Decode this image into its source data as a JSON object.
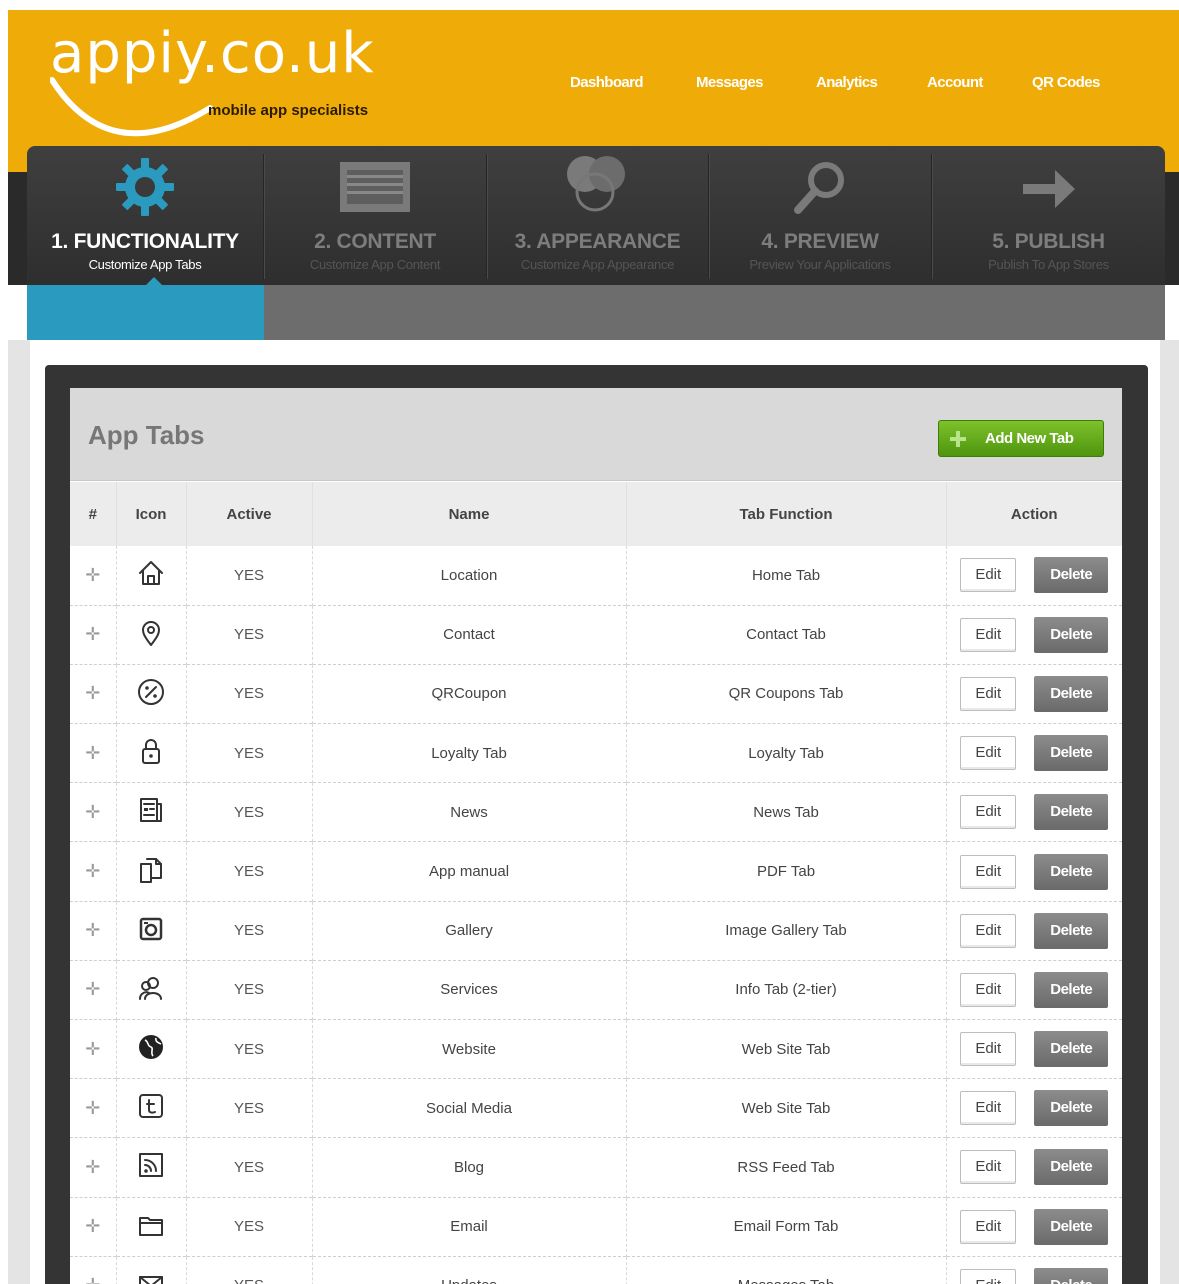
{
  "brand": {
    "name": "appiy.co.uk",
    "tagline": "mobile app specialists",
    "color": "#efac08"
  },
  "nav": [
    "Dashboard",
    "Messages",
    "Analytics",
    "Account",
    "QR Codes"
  ],
  "steps": [
    {
      "title": "1. FUNCTIONALITY",
      "subtitle": "Customize App Tabs",
      "icon": "gear-icon",
      "active": true
    },
    {
      "title": "2. CONTENT",
      "subtitle": "Customize App Content",
      "icon": "content-icon",
      "active": false
    },
    {
      "title": "3. APPEARANCE",
      "subtitle": "Customize App Appearance",
      "icon": "circles-icon",
      "active": false
    },
    {
      "title": "4. PREVIEW",
      "subtitle": "Preview Your Applications",
      "icon": "magnifier-icon",
      "active": false
    },
    {
      "title": "5. PUBLISH",
      "subtitle": "Publish To App Stores",
      "icon": "arrow-right-icon",
      "active": false
    }
  ],
  "progress": {
    "fraction": 0.2,
    "color": "#2a9bbf"
  },
  "panel": {
    "title": "App Tabs",
    "add_button": "Add New Tab"
  },
  "table": {
    "columns": [
      "#",
      "Icon",
      "Active",
      "Name",
      "Tab Function",
      "Action"
    ],
    "edit_label": "Edit",
    "delete_label": "Delete",
    "rows": [
      {
        "icon": "home-icon",
        "active": "YES",
        "name": "Location",
        "function": "Home Tab"
      },
      {
        "icon": "map-pin-icon",
        "active": "YES",
        "name": "Contact",
        "function": "Contact Tab"
      },
      {
        "icon": "percent-icon",
        "active": "YES",
        "name": "QRCoupon",
        "function": "QR Coupons Tab"
      },
      {
        "icon": "lock-icon",
        "active": "YES",
        "name": "Loyalty Tab",
        "function": "Loyalty Tab"
      },
      {
        "icon": "newspaper-icon",
        "active": "YES",
        "name": "News",
        "function": "News Tab"
      },
      {
        "icon": "documents-icon",
        "active": "YES",
        "name": "App manual",
        "function": "PDF Tab"
      },
      {
        "icon": "camera-icon",
        "active": "YES",
        "name": "Gallery",
        "function": "Image Gallery Tab"
      },
      {
        "icon": "people-icon",
        "active": "YES",
        "name": "Services",
        "function": "Info Tab (2-tier)"
      },
      {
        "icon": "globe-icon",
        "active": "YES",
        "name": "Website",
        "function": "Web Site Tab"
      },
      {
        "icon": "tumblr-icon",
        "active": "YES",
        "name": "Social Media",
        "function": "Web Site Tab"
      },
      {
        "icon": "rss-icon",
        "active": "YES",
        "name": "Blog",
        "function": "RSS Feed Tab"
      },
      {
        "icon": "folder-icon",
        "active": "YES",
        "name": "Email",
        "function": "Email Form Tab"
      },
      {
        "icon": "envelope-icon",
        "active": "YES",
        "name": "Updates",
        "function": "Messages Tab"
      }
    ]
  }
}
